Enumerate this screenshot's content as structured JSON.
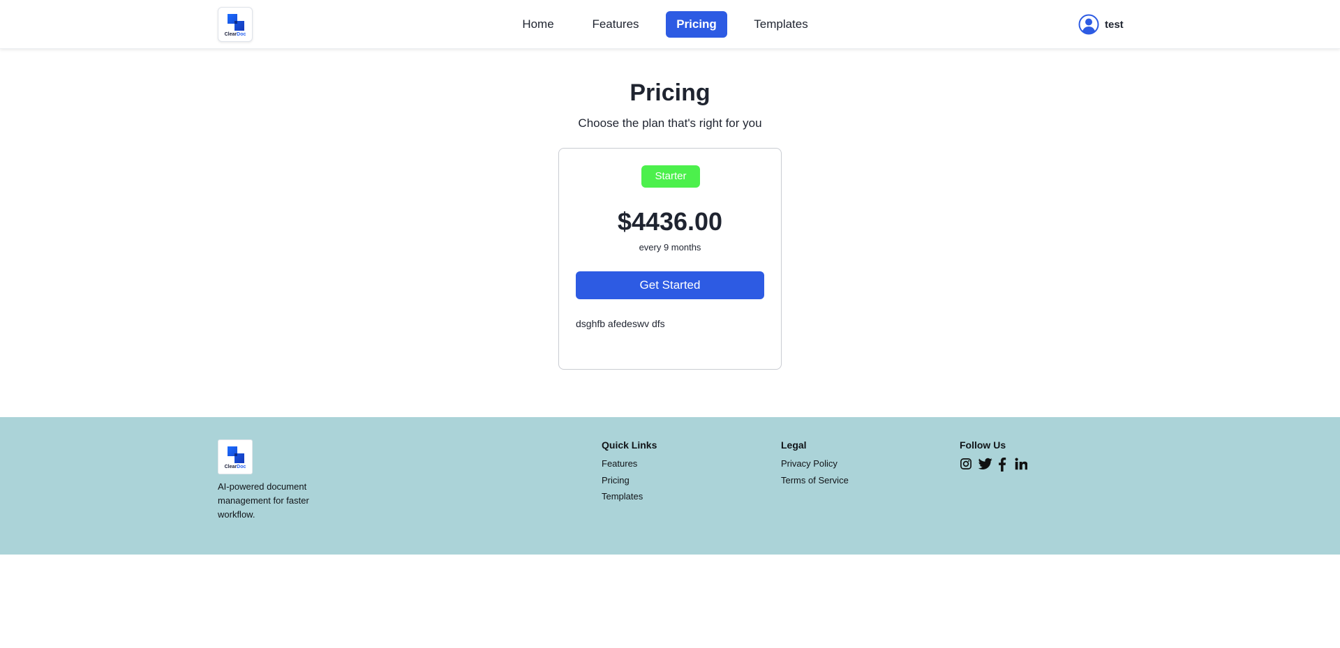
{
  "header": {
    "logo": {
      "brand_part1": "Clear",
      "brand_part2": "Doc"
    },
    "nav": [
      {
        "label": "Home",
        "active": false
      },
      {
        "label": "Features",
        "active": false
      },
      {
        "label": "Pricing",
        "active": true
      },
      {
        "label": "Templates",
        "active": false
      }
    ],
    "user": {
      "name": "test",
      "icon": "user-circle-icon"
    }
  },
  "main": {
    "title": "Pricing",
    "subtitle": "Choose the plan that's right for you",
    "plan": {
      "badge": "Starter",
      "badge_color": "#4cf04c",
      "price": "$4436.00",
      "period": "every 9 months",
      "cta": "Get Started",
      "feature": "dsghfb afedeswv dfs"
    }
  },
  "footer": {
    "tagline": "AI-powered document management for faster workflow.",
    "quick_links": {
      "title": "Quick Links",
      "items": [
        "Features",
        "Pricing",
        "Templates"
      ]
    },
    "legal": {
      "title": "Legal",
      "items": [
        "Privacy Policy",
        "Terms of Service"
      ]
    },
    "follow": {
      "title": "Follow Us",
      "icons": [
        "instagram-icon",
        "twitter-icon",
        "facebook-icon",
        "linkedin-icon"
      ]
    },
    "background": "#abd3d8"
  },
  "colors": {
    "accent": "#2d5be3",
    "text": "#1f2430"
  }
}
